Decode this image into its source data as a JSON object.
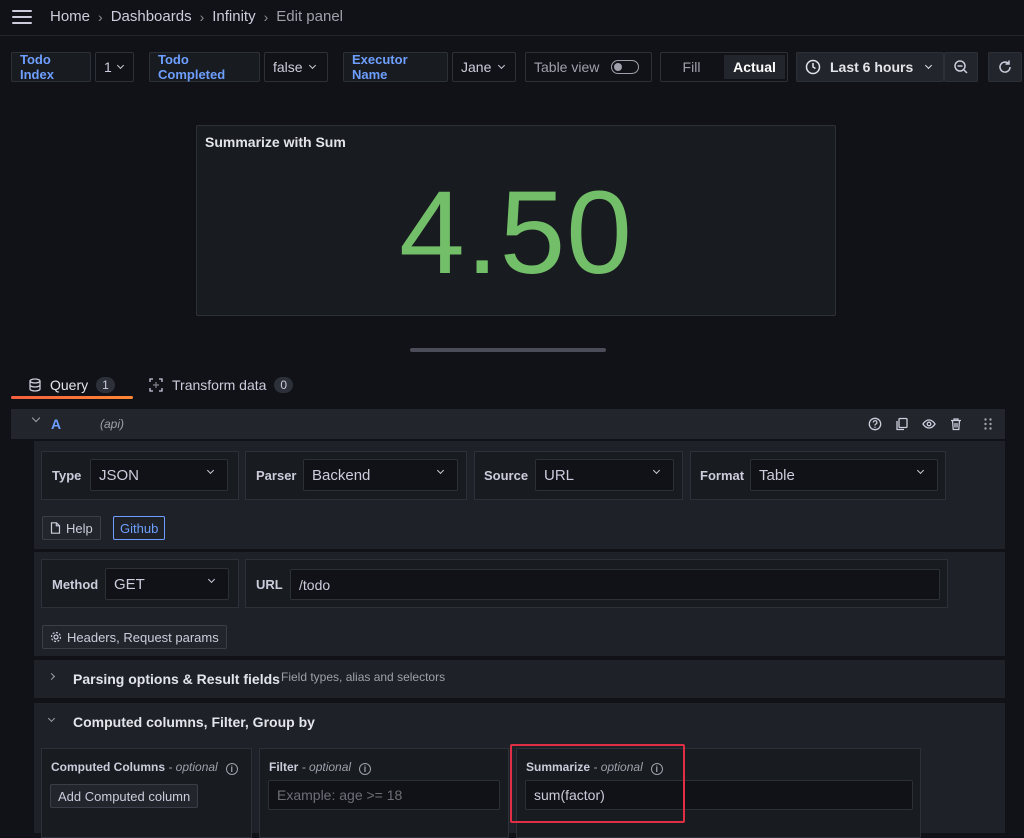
{
  "breadcrumb": {
    "items": [
      "Home",
      "Dashboards",
      "Infinity",
      "Edit panel"
    ]
  },
  "variables": [
    {
      "label": "Todo Index",
      "value": "1"
    },
    {
      "label": "Todo Completed",
      "value": "false"
    },
    {
      "label": "Executor Name",
      "value": "Jane"
    }
  ],
  "table_view": {
    "label": "Table view",
    "enabled": false
  },
  "fill_toggle": {
    "options": [
      "Fill",
      "Actual"
    ],
    "selected": "Actual"
  },
  "time_picker": {
    "label": "Last 6 hours"
  },
  "panel": {
    "title": "Summarize with Sum",
    "value": "4.50",
    "value_color": "#73bf69"
  },
  "tabs": [
    {
      "label": "Query",
      "count": "1",
      "icon": "database-icon",
      "active": true
    },
    {
      "label": "Transform data",
      "count": "0",
      "icon": "transform-icon",
      "active": false
    }
  ],
  "query": {
    "ref_id": "A",
    "datasource": "(api)",
    "type": {
      "label": "Type",
      "value": "JSON"
    },
    "parser": {
      "label": "Parser",
      "value": "Backend"
    },
    "source": {
      "label": "Source",
      "value": "URL"
    },
    "format": {
      "label": "Format",
      "value": "Table"
    },
    "help_label": "Help",
    "github_label": "Github",
    "method": {
      "label": "Method",
      "value": "GET"
    },
    "url": {
      "label": "URL",
      "value": "/todo"
    },
    "headers_label": "Headers, Request params",
    "parsing": {
      "title": "Parsing options & Result fields",
      "subtitle": "Field types, alias and selectors"
    },
    "computed": {
      "title": "Computed columns, Filter, Group by",
      "computed_columns_label": "Computed Columns",
      "optional": "- optional",
      "add_computed_label": "Add Computed column",
      "filter_label": "Filter",
      "filter_placeholder": "Example: age >= 18",
      "summarize_label": "Summarize",
      "summarize_value": "sum(factor)"
    }
  },
  "accent_color": "#6e9fff",
  "highlight_color": "#e02f44"
}
